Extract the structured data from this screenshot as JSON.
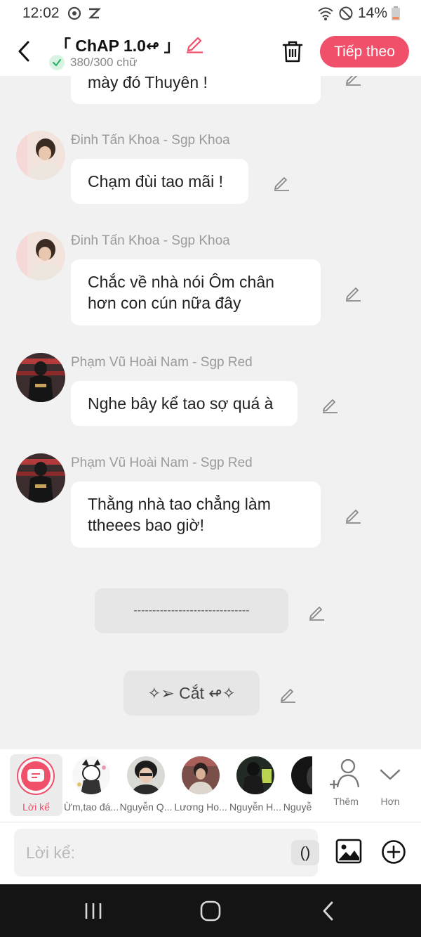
{
  "status_bar": {
    "time": "12:02",
    "battery": "14%",
    "icons": [
      "sync-icon",
      "no-sim-icon",
      "wifi-icon",
      "do-not-disturb-icon",
      "battery-icon"
    ]
  },
  "header": {
    "back_icon": "chevron-left-icon",
    "title": "「 ChAP 1.0↫ 」",
    "word_count": "380/300 chữ",
    "next_button": "Tiếp theo",
    "accent_color": "#f0506a"
  },
  "messages": [
    {
      "sender": "",
      "text": "mày đó Thuyên !"
    },
    {
      "sender": "Đinh Tấn Khoa - Sgp Khoa",
      "text": "Chạm đùi tao mãi !"
    },
    {
      "sender": "Đinh Tấn Khoa - Sgp Khoa",
      "line1": "Chắc về nhà nói Ôm chân",
      "line2": "hơn con cún nữa đây"
    },
    {
      "sender": "Phạm Vũ Hoài Nam  -  Sgp Red",
      "text": "Nghe bây kể tao sợ quá à"
    },
    {
      "sender": "Phạm Vũ Hoài Nam  -  Sgp Red",
      "line1": "Thằng nhà tao chẳng làm",
      "line2": "ttheees bao giờ!"
    }
  ],
  "narrations": [
    {
      "text": "-------------------------------"
    },
    {
      "text": "✧➢ Cắt ↫✧"
    }
  ],
  "characters": [
    {
      "label": "Lời kể"
    },
    {
      "label": "Ừm,tao đá..."
    },
    {
      "label": "Nguyễn Q..."
    },
    {
      "label": "Lương Ho..."
    },
    {
      "label": "Nguyễn H..."
    },
    {
      "label": "Nguyễ"
    }
  ],
  "tools": {
    "more_label": "Thêm",
    "more_icon": "add-person-icon",
    "other_label": "Hơn",
    "other_icon": "chevron-down-icon"
  },
  "composer": {
    "placeholder": "Lời kể:",
    "paren_button": "()"
  }
}
